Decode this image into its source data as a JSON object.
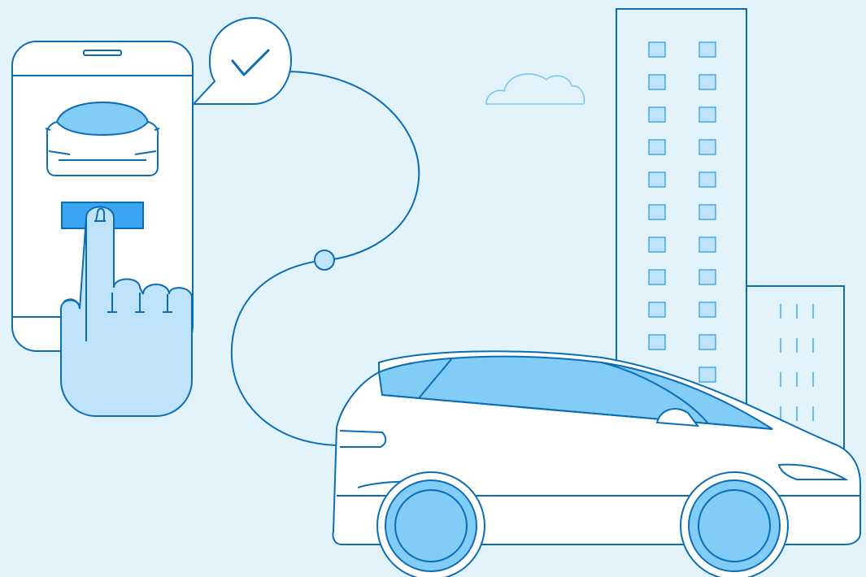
{
  "colors": {
    "background": "#E2F3FB",
    "stroke": "#0B6EB5",
    "light_fill": "#BEE3FA",
    "mid_fill": "#82CCF8",
    "accent": "#3AA5F2",
    "cloud": "#7DC6EE",
    "white": "#FFFFFF"
  },
  "icons": {
    "phone": "phone-icon",
    "checkmark": "checkmark-icon",
    "cloud": "cloud-icon",
    "car": "car-icon",
    "building": "building-icon",
    "pointing_hand": "pointing-hand-icon"
  }
}
